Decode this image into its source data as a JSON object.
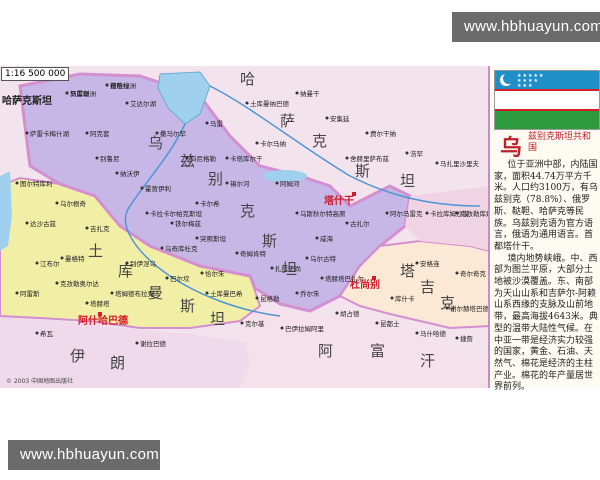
{
  "watermarks": {
    "top": "www.hbhuayun.com",
    "bottom": "www.hbhuayun.com"
  },
  "map": {
    "scale": "1:16 500 000",
    "copyright": "© 2003 中国地图出版社",
    "countries": {
      "uzbekistan_chars": [
        "乌",
        "兹",
        "别",
        "克",
        "斯",
        "坦"
      ],
      "turkmenistan_chars": [
        "土",
        "库",
        "曼",
        "斯",
        "坦"
      ],
      "kazakhstan": "哈萨克斯坦",
      "kazakh_chars": [
        "哈",
        "萨",
        "克",
        "斯",
        "坦"
      ],
      "afghanistan_chars": [
        "阿",
        "富",
        "汗"
      ],
      "iran_chars": [
        "伊",
        "朗"
      ],
      "tajik_chars": [
        "塔",
        "吉",
        "克",
        "斯",
        "坦"
      ]
    },
    "capitals": {
      "tashkent": "塔什干",
      "ashgabat": "阿什哈巴德",
      "dushanbe": "杜尚别"
    },
    "places": [
      "努库斯",
      "布哈拉",
      "撒马尔罕",
      "卡尔希",
      "铁尔梅兹",
      "纳沃伊",
      "乌尔根奇",
      "达沙古兹",
      "马雷",
      "土库曼纳巴德",
      "纳曼干",
      "安集延",
      "费尔干纳",
      "浩罕",
      "马扎里沙里夫",
      "克孜勒库姆沙漠",
      "卡拉库姆沙漠",
      "乌斯秋尔特高原",
      "咸海",
      "阿姆河",
      "锡尔河",
      "奇姆肯特",
      "突厥斯坦",
      "卡拉卡尔帕克斯坦",
      "吉扎克",
      "江布尔",
      "阿雷斯",
      "克孜勒奥尔达",
      "别伊涅乌",
      "巴尔坎",
      "土库曼巴希",
      "昆格勒",
      "乔尔朱",
      "胡占德",
      "昆都士",
      "马什哈德",
      "捷詹",
      "谢拉巴德",
      "希瓦",
      "塔赫塔",
      "古扎尔",
      "阿尔马雷克",
      "安格连",
      "奇尔奇克",
      "卡尔马纳",
      "科尼格勒",
      "阿克套",
      "萨雷卡梅什湖",
      "艾达尔湖",
      "舍赫里萨布兹",
      "乌尔古特",
      "卡塔库尔干",
      "扎拉夫尚",
      "乌奇库杜克",
      "塔姆德布拉克",
      "曼格特",
      "图尔特库利",
      "别鲁尼",
      "霍贾伊利",
      "恰尔朱",
      "克尔基",
      "巴伊拉姆阿里",
      "塔赫塔巴扎尔",
      "库什卡",
      "谢尔赫塔巴德",
      "马雷绿洲",
      "捷詹绿洲"
    ]
  },
  "panel": {
    "country_big_char": "乌",
    "country_name": "兹别克斯坦共和国",
    "paragraph1": "位于亚洲中部，内陆国家，面积44.74万平方千米。人口约3100万，有乌兹别克（78.8%）、俄罗斯、鞑靼、哈萨克等民族。乌兹别克语为官方语言，俄语为通用语言。首都塔什干。",
    "paragraph2": "境内地势峡峨。中、西部为图兰平原，大部分土地被沙漠覆盖。东、南部为天山山系和吉萨尔-阿赖山系西缘的支脉及山前地带，最高海拔4643米。典型的温带大陆性气候。在中亚一带是经济实力较强的国家，黄金、石油、天然气、棉花是经济的主柱产业。棉花的年产量居世界前列。"
  },
  "colors": {
    "uzbekistan": "#c6b7e6",
    "turkmenistan": "#f1efa6",
    "kazakhstan": "#f3e3ed",
    "afghanistan": "#f6e0e9",
    "iran": "#efd9ea",
    "tajikistan": "#fbe9d6",
    "water": "#9fd1ee",
    "border": "#d48fd0"
  },
  "flag_icon": "uzbekistan-flag-icon"
}
